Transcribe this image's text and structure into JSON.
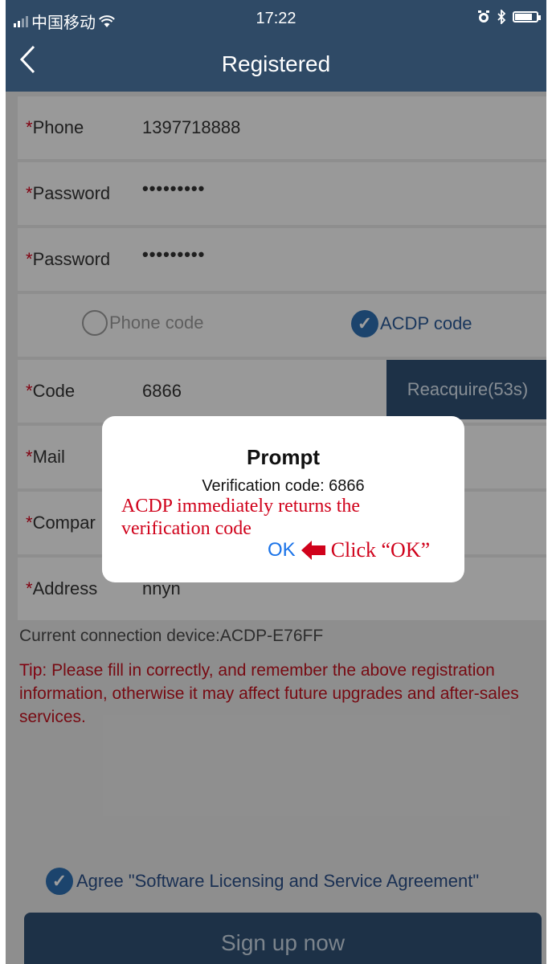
{
  "status_bar": {
    "carrier": "中国移动",
    "time": "17:22"
  },
  "nav": {
    "back_icon": "chevron-left-icon",
    "title": "Registered"
  },
  "form": {
    "phone": {
      "required_mark": "*",
      "label": "Phone",
      "value": "1397718888"
    },
    "password": {
      "required_mark": "*",
      "label": "Password",
      "value": "•••••••••"
    },
    "password_confirm": {
      "required_mark": "*",
      "label": "Password",
      "value": "•••••••••"
    },
    "code_options": [
      {
        "label": "Phone code",
        "selected": false
      },
      {
        "label": "ACDP code",
        "selected": true
      }
    ],
    "code": {
      "required_mark": "*",
      "label": "Code",
      "value": "6866",
      "button": "Reacquire(53s)"
    },
    "mail": {
      "required_mark": "*",
      "label": "Mail",
      "value": ""
    },
    "company": {
      "required_mark": "*",
      "label": "Compar",
      "value": ""
    },
    "address": {
      "required_mark": "*",
      "label": "Address",
      "value": "nnyn"
    }
  },
  "device_text": "Current connection device:ACDP-E76FF",
  "tip": {
    "label": "Tip",
    "text": ": Please fill in correctly, and remember the above registration information, otherwise it may affect future upgrades and after-sales services."
  },
  "agreement": {
    "checked": true,
    "text": "Agree \"Software Licensing and Service Agreement\""
  },
  "signup_button": "Sign up now",
  "dialog": {
    "title": "Prompt",
    "message": "Verification code: 6866",
    "annotation_line1": "ACDP immediately returns the",
    "annotation_line2": "verification code",
    "ok_label": "OK",
    "click_annotation": "Click “OK”"
  },
  "colors": {
    "nav_bg": "#2f4a66",
    "button_bg": "#2f4f73",
    "check_blue": "#2e6fb0",
    "required_red": "#d0021b",
    "ok_blue": "#1a73e8"
  }
}
